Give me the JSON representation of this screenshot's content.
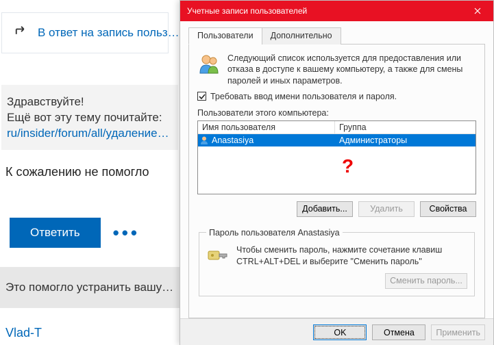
{
  "forum": {
    "reply_to_link": "В ответ на запись польз…",
    "greeting_line1": "Здравствуйте!",
    "greeting_line2": "Ещё вот эту тему почитайте:",
    "greeting_link": "ru/insider/forum/all/удаление…",
    "no_help": "К сожалению не помогло",
    "reply_button": "Ответить",
    "resolved_text": "Это помогло устранить вашу…",
    "author": "Vlad-T"
  },
  "dialog": {
    "title": "Учетные записи пользователей",
    "tabs": [
      "Пользователи",
      "Дополнительно"
    ],
    "info_text": "Следующий список используется для предоставления или отказа в доступе к вашему компьютеру, а также для смены паролей и иных параметров.",
    "require_login_label": "Требовать ввод имени пользователя и пароля.",
    "require_login_checked": true,
    "list_caption": "Пользователи этого компьютера:",
    "columns": {
      "user": "Имя пользователя",
      "group": "Группа"
    },
    "rows": [
      {
        "user": "Anastasiya",
        "group": "Администраторы",
        "selected": true
      }
    ],
    "question_mark": "?",
    "buttons": {
      "add": "Добавить...",
      "remove": "Удалить",
      "properties": "Свойства"
    },
    "password_group_legend": "Пароль пользователя Anastasiya",
    "password_hint": "Чтобы сменить пароль, нажмите сочетание клавиш CTRL+ALT+DEL и выберите \"Сменить пароль\"",
    "change_password_btn": "Сменить пароль...",
    "footer": {
      "ok": "OK",
      "cancel": "Отмена",
      "apply": "Применить"
    }
  }
}
